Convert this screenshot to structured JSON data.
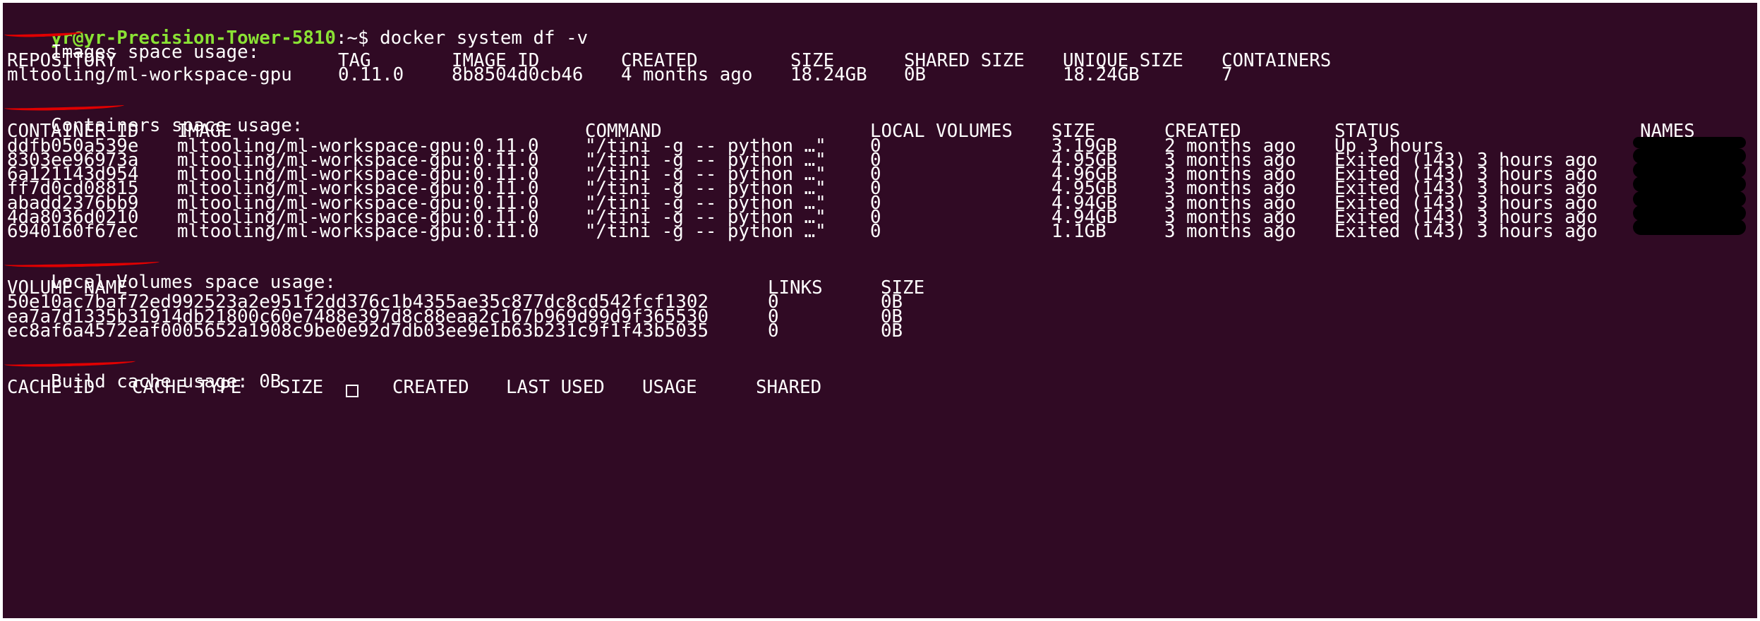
{
  "prompt": {
    "user_host": "yr@yr-Precision-Tower-5810",
    "path": ":~",
    "symbol": "$",
    "command": "docker system df -v"
  },
  "images_section": {
    "title_word": "Images",
    "title_rest": " space usage:",
    "headers": [
      "REPOSITORY",
      "TAG",
      "IMAGE ID",
      "CREATED",
      "SIZE",
      "SHARED SIZE",
      "UNIQUE SIZE",
      "CONTAINERS"
    ],
    "rows": [
      [
        "mltooling/ml-workspace-gpu",
        "0.11.0",
        "8b8504d0cb46",
        "4 months ago",
        "18.24GB",
        "0B",
        "18.24GB",
        "7"
      ]
    ]
  },
  "containers_section": {
    "title_word": "Containers",
    "title_rest": " space usage:",
    "headers": [
      "CONTAINER ID",
      "IMAGE",
      "COMMAND",
      "LOCAL VOLUMES",
      "SIZE",
      "CREATED",
      "STATUS",
      "NAMES"
    ],
    "rows": [
      [
        "ddfb050a539e",
        "mltooling/ml-workspace-gpu:0.11.0",
        "\"/tini -g -- python …\"",
        "0",
        "3.19GB",
        "2 months ago",
        "Up 3 hours"
      ],
      [
        "8303ee96973a",
        "mltooling/ml-workspace-gpu:0.11.0",
        "\"/tini -g -- python …\"",
        "0",
        "4.95GB",
        "3 months ago",
        "Exited (143) 3 hours ago"
      ],
      [
        "6a121143d954",
        "mltooling/ml-workspace-gpu:0.11.0",
        "\"/tini -g -- python …\"",
        "0",
        "4.96GB",
        "3 months ago",
        "Exited (143) 3 hours ago"
      ],
      [
        "ff7d0cd08815",
        "mltooling/ml-workspace-gpu:0.11.0",
        "\"/tini -g -- python …\"",
        "0",
        "4.95GB",
        "3 months ago",
        "Exited (143) 3 hours ago"
      ],
      [
        "abadd2376bb9",
        "mltooling/ml-workspace-gpu:0.11.0",
        "\"/tini -g -- python …\"",
        "0",
        "4.94GB",
        "3 months ago",
        "Exited (143) 3 hours ago"
      ],
      [
        "4da8036d0210",
        "mltooling/ml-workspace-gpu:0.11.0",
        "\"/tini -g -- python …\"",
        "0",
        "4.94GB",
        "3 months ago",
        "Exited (143) 3 hours ago"
      ],
      [
        "6940160f67ec",
        "mltooling/ml-workspace-gpu:0.11.0",
        "\"/tini -g -- python …\"",
        "0",
        "1.1GB",
        "3 months ago",
        "Exited (143) 3 hours ago"
      ]
    ]
  },
  "volumes_section": {
    "title_word": "Local Volumes",
    "title_rest": " space usage:",
    "headers": [
      "VOLUME NAME",
      "LINKS",
      "SIZE"
    ],
    "rows": [
      [
        "50e10ac7baf72ed992523a2e951f2dd376c1b4355ae35c877dc8cd542fcf1302",
        "0",
        "0B"
      ],
      [
        "ea7a7d1335b31914db21800c60e7488e397d8c88eaa2c167b969d99d9f365530",
        "0",
        "0B"
      ],
      [
        "ec8af6a4572eaf0005652a1908c9be0e92d7db03ee9e1b63b231c9f1f43b5035",
        "0",
        "0B"
      ]
    ]
  },
  "build_cache_section": {
    "title_word": "Build cache",
    "title_rest": " usage: 0B",
    "headers": [
      "CACHE ID",
      "CACHE TYPE",
      "SIZE",
      "CREATED",
      "LAST USED",
      "USAGE",
      "SHARED"
    ]
  },
  "colors": {
    "terminal_bg": "#300a24",
    "prompt_user": "#8ae234",
    "prompt_path": "#729fcf",
    "annotation_red": "#e00000"
  }
}
